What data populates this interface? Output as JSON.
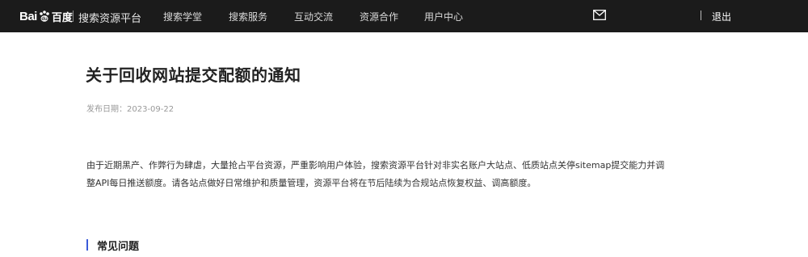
{
  "header": {
    "logo_text_latin": "Bai",
    "logo_text_cn": "百度",
    "platform_title": "搜索资源平台",
    "nav": [
      "搜索学堂",
      "搜索服务",
      "互动交流",
      "资源合作",
      "用户中心"
    ],
    "mail_icon": "mail-icon",
    "logout_label": "退出"
  },
  "article": {
    "title": "关于回收网站提交配额的通知",
    "date_label": "发布日期：",
    "date_value": "2023-09-22",
    "body": "由于近期黑产、作弊行为肆虐，大量抢占平台资源，严重影响用户体验，搜索资源平台针对非实名账户大站点、低质站点关停sitemap提交能力并调整API每日推送额度。请各站点做好日常维护和质量管理，资源平台将在节后陆续为合规站点恢复权益、调高额度。"
  },
  "faq": {
    "heading": "常见问题"
  },
  "colors": {
    "topbar": "#1b1b1b",
    "accent": "#3a5bd9"
  }
}
